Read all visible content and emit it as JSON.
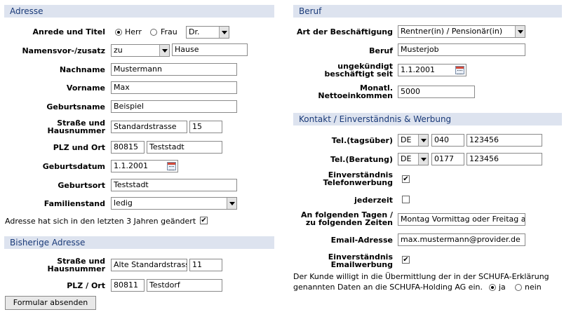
{
  "address": {
    "header": "Adresse",
    "salutation_label": "Anrede und Titel",
    "mr_label": "Herr",
    "mrs_label": "Frau",
    "title_value": "Dr.",
    "name_prefix_label": "Namensvor-/zusatz",
    "name_prefix_value": "zu",
    "name_suffix_value": "Hause",
    "lastname_label": "Nachname",
    "lastname_value": "Mustermann",
    "firstname_label": "Vorname",
    "firstname_value": "Max",
    "birthname_label": "Geburtsname",
    "birthname_value": "Beispiel",
    "street_label_1": "Straße und",
    "street_label_2": "Hausnummer",
    "street_value": "Standardstrasse",
    "housenumber_value": "15",
    "city_label": "PLZ und Ort",
    "zip_value": "80815",
    "city_value": "Teststadt",
    "birthdate_label": "Geburtsdatum",
    "birthdate_value": "1.1.2001",
    "birthplace_label": "Geburtsort",
    "birthplace_value": "Teststadt",
    "marital_label": "Familienstand",
    "marital_value": "ledig",
    "changed_label": "Adresse hat sich in den letzten 3 Jahren geändert"
  },
  "previous_address": {
    "header": "Bisherige Adresse",
    "street_label_1": "Straße und",
    "street_label_2": "Hausnummer",
    "street_value": "Alte Standardstrasse",
    "housenumber_value": "11",
    "city_label": "PLZ / Ort",
    "zip_value": "80811",
    "city_value": "Testdorf"
  },
  "submit_label": "Formular absenden",
  "job": {
    "header": "Beruf",
    "employment_label": "Art der Beschäftigung",
    "employment_value": "Rentner(in) / Pensionär(in)",
    "job_label": "Beruf",
    "job_value": "Musterjob",
    "since_label_1": "ungekündigt",
    "since_label_2": "beschäftigt seit",
    "since_value": "1.1.2001",
    "income_label_1": "Monatl.",
    "income_label_2": "Nettoeinkommen",
    "income_value": "5000"
  },
  "contact": {
    "header": "Kontakt / Einverständnis & Werbung",
    "phone_day_label": "Tel.(tagsüber)",
    "phone_day_country": "DE",
    "phone_day_area": "040",
    "phone_day_number": "123456",
    "phone_advice_label": "Tel.(Beratung)",
    "phone_advice_country": "DE",
    "phone_advice_area": "0177",
    "phone_advice_number": "123456",
    "phone_consent_label_1": "Einverständnis",
    "phone_consent_label_2": "Telefonwerbung",
    "anytime_label": "jederzeit",
    "days_label_1": "An folgenden Tagen /",
    "days_label_2": "zu folgenden Zeiten",
    "days_value": "Montag Vormittag oder Freitag ab",
    "email_label": "Email-Adresse",
    "email_value": "max.mustermann@provider.de",
    "email_consent_label_1": "Einverständnis",
    "email_consent_label_2": "Emailwerbung",
    "schufa_text_1": "Der Kunde willigt in die Übermittlung der in der SCHUFA-Erklärung",
    "schufa_text_2": "genannten Daten an die SCHUFA-Holding AG ein.",
    "yes_label": "ja",
    "no_label": "nein"
  },
  "checkmark": "✔"
}
